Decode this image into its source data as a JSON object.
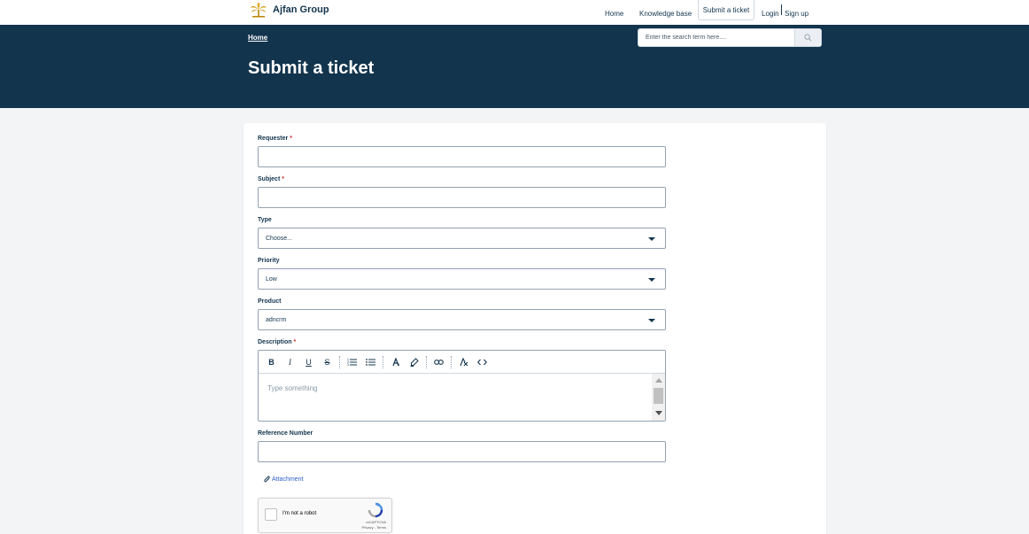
{
  "header": {
    "brand": "Ajfan Group",
    "nav": {
      "home": "Home",
      "knowledge_base": "Knowledge base",
      "submit_ticket": "Submit a ticket",
      "login": "Login",
      "signup": "Sign up"
    }
  },
  "hero": {
    "breadcrumb": "Home",
    "title": "Submit a ticket",
    "search_placeholder": "Enter the search term here....",
    "background_color": "#12344d"
  },
  "form": {
    "requester": {
      "label": "Requester",
      "value": ""
    },
    "subject": {
      "label": "Subject",
      "value": ""
    },
    "type": {
      "label": "Type",
      "value": "Choose..."
    },
    "priority": {
      "label": "Priority",
      "value": "Low"
    },
    "product": {
      "label": "Product",
      "value": "adncrm"
    },
    "description": {
      "label": "Description",
      "placeholder": "Type something",
      "toolbar": [
        "bold-icon",
        "italic-icon",
        "underline-icon",
        "strikethrough-icon",
        "numbered-list-icon",
        "bullet-list-icon",
        "font-color-icon",
        "highlight-icon",
        "link-icon",
        "clear-format-icon",
        "code-icon"
      ]
    },
    "reference_number": {
      "label": "Reference Number",
      "value": ""
    },
    "attachment": "Attachment",
    "required_marker": "*"
  },
  "captcha": {
    "label": "I'm not a robot",
    "brand": "reCAPTCHA",
    "links": "Privacy - Terms"
  }
}
